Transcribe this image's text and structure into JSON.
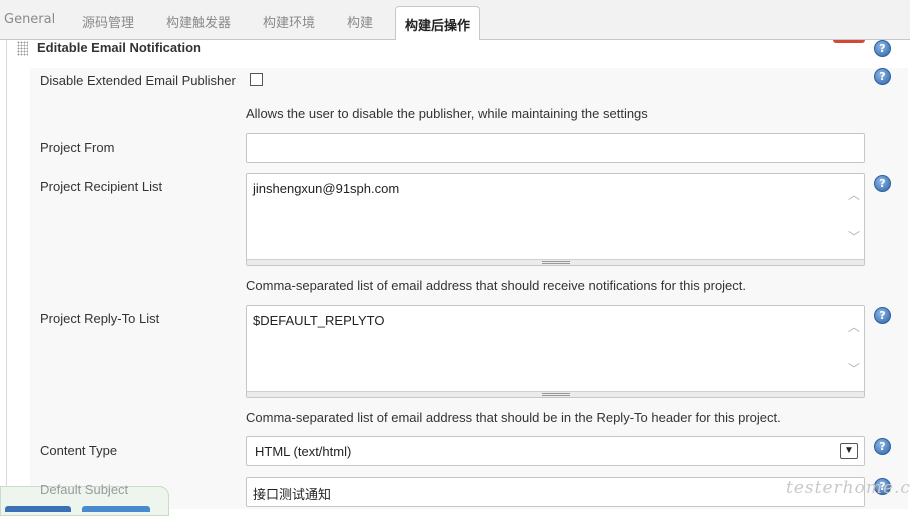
{
  "tabs": [
    {
      "label": "General"
    },
    {
      "label": "源码管理"
    },
    {
      "label": "构建触发器"
    },
    {
      "label": "构建环境"
    },
    {
      "label": "构建"
    },
    {
      "label": "构建后操作",
      "active": true
    }
  ],
  "section": {
    "title": "Editable Email Notification"
  },
  "fields": {
    "disable_publisher": {
      "label": "Disable Extended Email Publisher",
      "checked": false,
      "description": "Allows the user to disable the publisher, while maintaining the settings"
    },
    "project_from": {
      "label": "Project From",
      "value": ""
    },
    "recipient_list": {
      "label": "Project Recipient List",
      "value": "jinshengxun@91sph.com",
      "description": "Comma-separated list of email address that should receive notifications for this project."
    },
    "reply_to_list": {
      "label": "Project Reply-To List",
      "value": "$DEFAULT_REPLYTO",
      "description": "Comma-separated list of email address that should be in the Reply-To header for this project."
    },
    "content_type": {
      "label": "Content Type",
      "selected": "HTML (text/html)"
    },
    "default_subject": {
      "label": "Default Subject",
      "value": "接口测试通知"
    }
  },
  "help_glyph": "?",
  "watermark": "testerhome.com",
  "colors": {
    "help_icon": "#2b63a8",
    "tab_bar": "#f2f2f2",
    "accent_red": "#d24939"
  }
}
